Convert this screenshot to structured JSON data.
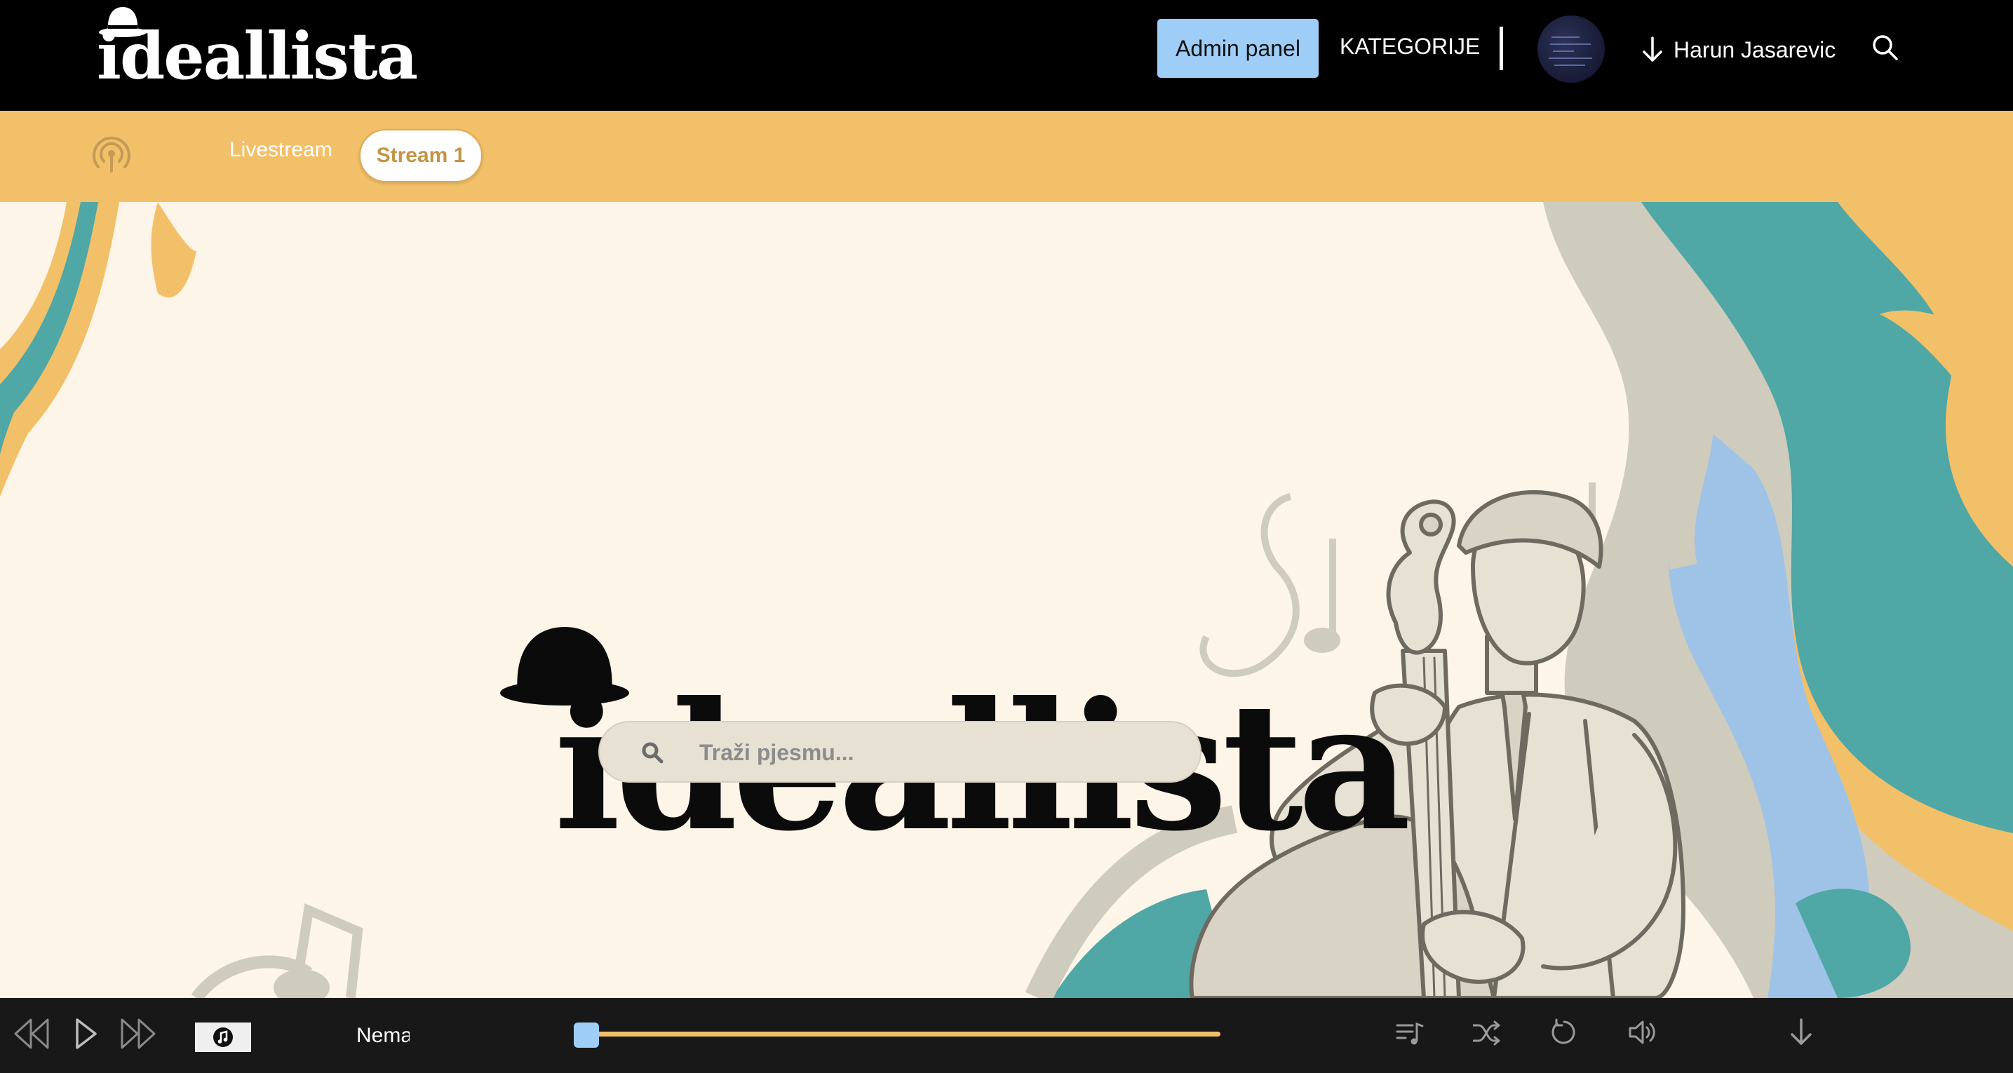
{
  "header": {
    "logo_text": "ideallista",
    "admin_label": "Admin panel",
    "categories_label": "KATEGORIJE",
    "user_name": "Harun Jasarevic"
  },
  "streams": {
    "livestream_label": "Livestream",
    "active_stream": "Stream 1"
  },
  "hero": {
    "logo_text": "ideallista",
    "search_placeholder": "Traži pjesmu...",
    "search_value": ""
  },
  "player": {
    "track_title": "Nema",
    "progress": 0
  },
  "colors": {
    "header_bg": "#000000",
    "accent_yellow": "#f2c068",
    "accent_blue": "#9ecdf7",
    "teal": "#4fa7a6",
    "cream": "#fdf5e8",
    "player_bg": "#181818"
  },
  "icons": {
    "radio": "broadcast-icon",
    "user_arrow": "arrow-down-icon",
    "search": "search-icon",
    "prev": "skip-back-icon",
    "play": "play-icon",
    "next": "skip-forward-icon",
    "music": "music-note-icon",
    "queue": "playlist-icon",
    "shuffle": "shuffle-icon",
    "repeat": "repeat-icon",
    "volume": "volume-icon",
    "collapse": "arrow-down-icon"
  }
}
